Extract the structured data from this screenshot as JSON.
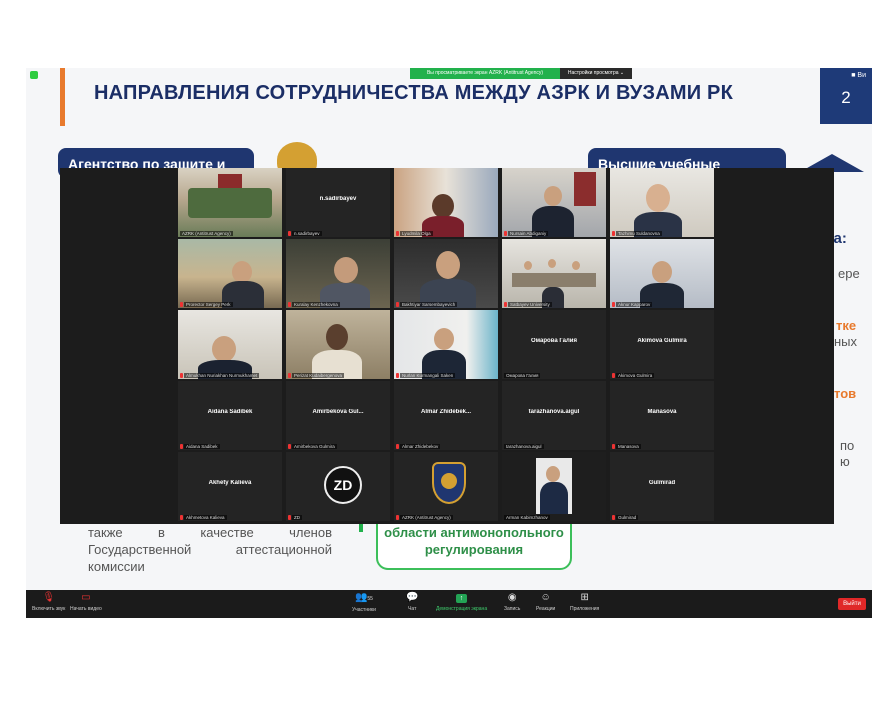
{
  "slide": {
    "title": "НАПРАВЛЕНИЯ СОТРУДНИЧЕСТВА МЕЖДУ АЗРК И ВУЗАМИ РК",
    "page_number": "2",
    "page_small": "■ Ви",
    "left_heading": "Агентство по защите и",
    "right_heading": "Высшие учебные",
    "right_fragments": [
      "ка:",
      "ере",
      "тке",
      "ных",
      "тов",
      "по",
      "ю"
    ],
    "bottom_left_text": [
      "также в качестве членов",
      "Государственной аттестационной",
      "комиссии"
    ],
    "green_box_text": [
      "области антимонопольного",
      "регулирования"
    ]
  },
  "share_bar": {
    "status": "Вы просматриваете экран AZRK (Antitrust Agency)",
    "view_options": "Настройки просмотра ⌄"
  },
  "participants": [
    {
      "name": "AZRK (Antitrust Agency)",
      "video": true
    },
    {
      "name": "n.sadirbayev",
      "video": false,
      "display": "n.sadirbayev"
    },
    {
      "name": "Lyudmila Olga",
      "video": true
    },
    {
      "name": "Nursain Abdiganiy",
      "video": true
    },
    {
      "name": "Tazhimu Suldanovna",
      "video": true
    },
    {
      "name": "Prorector Sergey Perk",
      "video": true
    },
    {
      "name": "Kuralay Kenzhekovna",
      "video": true
    },
    {
      "name": "Bakhtiyar Sarsembayevich",
      "video": true
    },
    {
      "name": "Satbayev University",
      "video": true
    },
    {
      "name": "Aknur Kapparov",
      "video": true
    },
    {
      "name": "Almukhan Nuriakhan Nurmukhamet",
      "video": true
    },
    {
      "name": "Perizat Kudaibergenova",
      "video": true
    },
    {
      "name": "Nurlan Kurmangali Saken",
      "video": true
    },
    {
      "name": "Омарова Галия",
      "video": false,
      "display": "Омарова Галия"
    },
    {
      "name": "Akimova Gulmira",
      "video": false,
      "display": "Akimova Gulmira"
    },
    {
      "name": "Aidana Sadibek",
      "video": false,
      "display": "Aidana Sadibek"
    },
    {
      "name": "Amirbekova Gulmira",
      "video": false,
      "display": "Amirbekova Gul..."
    },
    {
      "name": "Almar Zhidebekov",
      "video": false,
      "display": "Almar Zhidebek..."
    },
    {
      "name": "tarazhanova.aigul",
      "video": false,
      "display": "tarazhanova.aigul"
    },
    {
      "name": "Manasova",
      "video": false,
      "display": "Manasova"
    },
    {
      "name": "Akhmetova Kalieva",
      "video": false,
      "display": "Akhety Kalieva"
    },
    {
      "name": "ZD",
      "video": false,
      "logo": "zd"
    },
    {
      "name": "AZRK (Antitrust Agency)",
      "video": false,
      "logo": "emblem"
    },
    {
      "name": "Arman Kabimzhanov",
      "video": true
    },
    {
      "name": "Gulmirad",
      "video": false,
      "display": "Gulmirad"
    }
  ],
  "toolbar": {
    "mute": "Включить звук",
    "video": "Начать видео",
    "participants": "Участники",
    "participants_count": "55",
    "chat": "Чат",
    "share": "Демонстрация экрана",
    "reactions": "Запись",
    "more": "Реакции",
    "apps": "Приложения",
    "end": "Выйти"
  },
  "colors": {
    "slide_navy": "#1f3670",
    "accent_orange": "#e87a2d",
    "zoom_green": "#22b14c",
    "end_red": "#e02828",
    "gallery_bg": "#1c1c1c"
  }
}
